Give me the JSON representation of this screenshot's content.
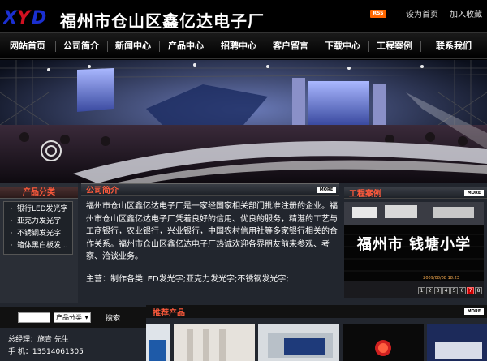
{
  "header": {
    "logo_text": "XYD",
    "company_name": "福州市仓山区鑫亿达电子厂",
    "rss_label": "RSS",
    "links": [
      "设为首页",
      "加入收藏"
    ]
  },
  "nav": {
    "items": [
      "网站首页",
      "公司简介",
      "新闻中心",
      "产品中心",
      "招聘中心",
      "客户留言",
      "下载中心",
      "工程案例",
      "联系我们"
    ]
  },
  "sidebar": {
    "title": "产品分类",
    "items": [
      "银行LED发光字",
      "亚克力发光字",
      "不锈钢发光字",
      "箱体黑白板发..."
    ]
  },
  "about": {
    "title": "公司简介",
    "more": "MORE",
    "paragraph": "福州市仓山区鑫亿达电子厂是一家经国家相关部门批准注册的企业。福州市仓山区鑫亿达电子厂凭着良好的信用、优良的服务，精湛的工艺与工商银行，农业银行，兴业银行，中国农村信用社等多家银行相关的合作关系。福州市仓山区鑫亿达电子厂热诚欢迎各界朋友前来参观、考察、洽谈业务。",
    "services": "主营：制作各类LED发光字;亚克力发光字;不锈钢发光字;"
  },
  "cases": {
    "title": "工程案例",
    "more": "MORE",
    "sign_text": "福州市 钱塘小学",
    "timestamp": "2009/08/08 18:23",
    "pages": [
      "1",
      "2",
      "3",
      "4",
      "5",
      "6",
      "7",
      "8"
    ],
    "active_page": "7"
  },
  "search": {
    "select_value": "产品分类",
    "button": "搜索"
  },
  "contact": {
    "manager": "总经理：施青 先生",
    "phone": "手 机：13514061305"
  },
  "products": {
    "title": "推荐产品",
    "more": "MORE"
  },
  "colors": {
    "accent_red": "#ff5a3c",
    "logo_blue": "#1a2fd0",
    "logo_red": "#d01020",
    "background": "#22262e"
  }
}
